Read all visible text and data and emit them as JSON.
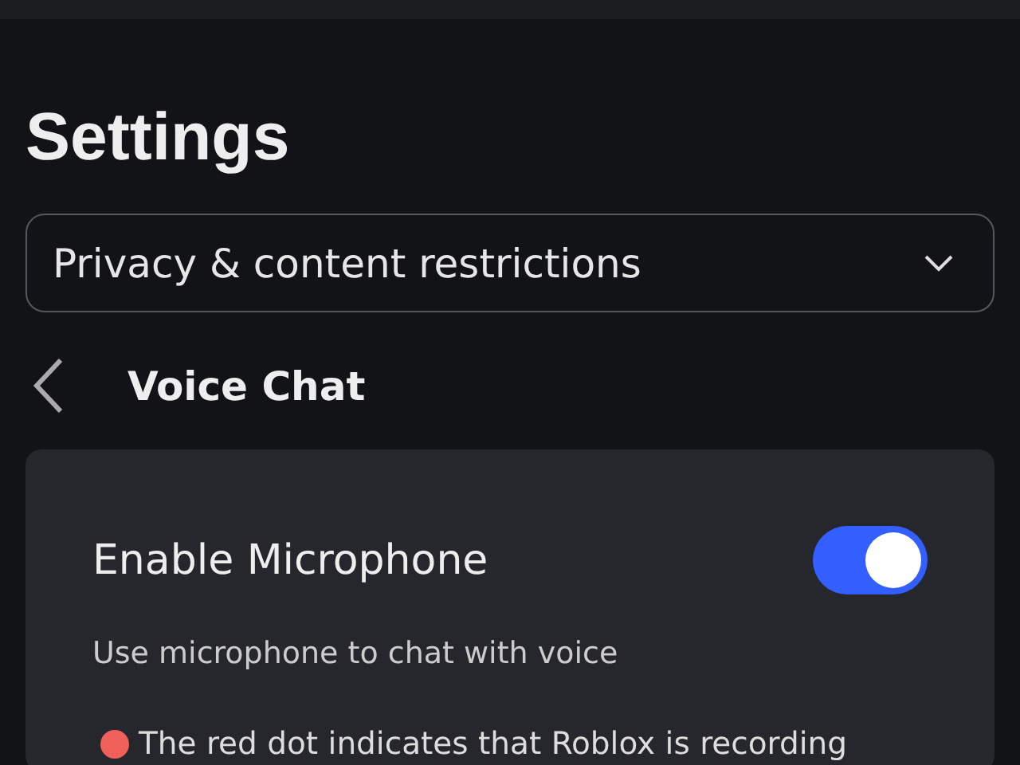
{
  "header": {
    "title": "Settings"
  },
  "category_dropdown": {
    "value": "Privacy & content restrictions"
  },
  "section": {
    "title": "Voice Chat"
  },
  "setting": {
    "label": "Enable Microphone",
    "on": true,
    "description": "Use microphone to chat with voice",
    "note": "The red dot indicates that Roblox is recording"
  }
}
